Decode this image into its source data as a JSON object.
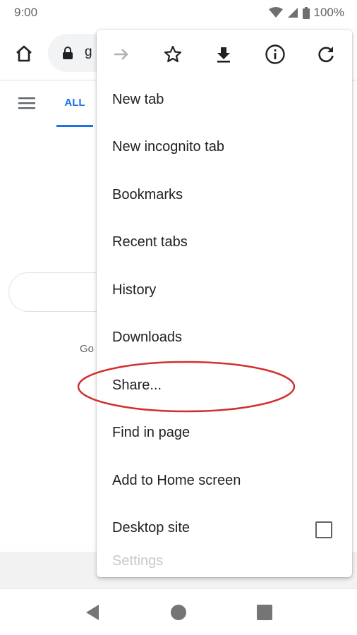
{
  "status_bar": {
    "time": "9:00",
    "battery": "100%"
  },
  "toolbar": {
    "url_partial": "g"
  },
  "page": {
    "tab_label": "ALL",
    "partial_text": "Go"
  },
  "menu": {
    "icons": [
      "forward-icon",
      "star-icon",
      "download-icon",
      "info-icon",
      "refresh-icon"
    ],
    "items": [
      {
        "label": "New tab"
      },
      {
        "label": "New incognito tab"
      },
      {
        "label": "Bookmarks"
      },
      {
        "label": "Recent tabs"
      },
      {
        "label": "History"
      },
      {
        "label": "Downloads"
      },
      {
        "label": "Share..."
      },
      {
        "label": "Find in page"
      },
      {
        "label": "Add to Home screen"
      },
      {
        "label": "Desktop site",
        "checked": false
      },
      {
        "label": "Settings"
      }
    ]
  },
  "colors": {
    "accent": "#1a73e8",
    "annotation": "#d32f2f",
    "icon": "#202124"
  }
}
